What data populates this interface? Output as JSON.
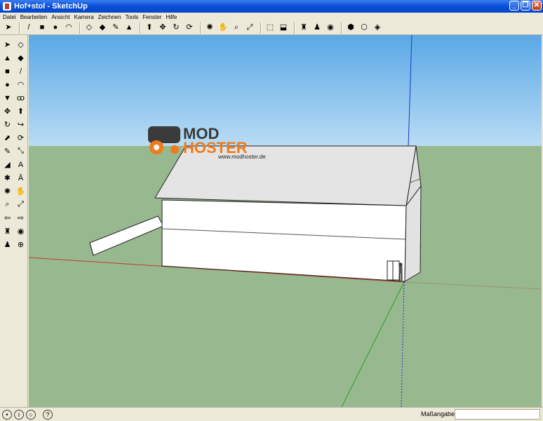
{
  "window": {
    "title": "Hof+stol - SketchUp"
  },
  "menu": [
    {
      "label": "Datei"
    },
    {
      "label": "Bearbeiten"
    },
    {
      "label": "Ansicht"
    },
    {
      "label": "Kamera"
    },
    {
      "label": "Zeichnen"
    },
    {
      "label": "Tools"
    },
    {
      "label": "Fenster"
    },
    {
      "label": "Hilfe"
    }
  ],
  "toolbar": [
    {
      "icon": "select-arrow-icon",
      "glyph": "➤"
    },
    {
      "icon": "sep"
    },
    {
      "icon": "line-pencil-icon",
      "glyph": "/"
    },
    {
      "icon": "rectangle-icon",
      "glyph": "■"
    },
    {
      "icon": "circle-icon",
      "glyph": "●"
    },
    {
      "icon": "arc-icon",
      "glyph": "◠"
    },
    {
      "icon": "sep"
    },
    {
      "icon": "make-component-icon",
      "glyph": "◇"
    },
    {
      "icon": "eraser-icon",
      "glyph": "◆"
    },
    {
      "icon": "tape-measure-icon",
      "glyph": "✎"
    },
    {
      "icon": "paint-bucket-icon",
      "glyph": "▲"
    },
    {
      "icon": "sep"
    },
    {
      "icon": "push-pull-icon",
      "glyph": "⬆"
    },
    {
      "icon": "move-icon",
      "glyph": "✥"
    },
    {
      "icon": "rotate-icon",
      "glyph": "↻"
    },
    {
      "icon": "offset-icon",
      "glyph": "⟳"
    },
    {
      "icon": "sep"
    },
    {
      "icon": "orbit-icon",
      "glyph": "✺"
    },
    {
      "icon": "pan-icon",
      "glyph": "✋"
    },
    {
      "icon": "zoom-icon",
      "glyph": "⌕"
    },
    {
      "icon": "zoom-extents-icon",
      "glyph": "⤢"
    },
    {
      "icon": "sep"
    },
    {
      "icon": "get-models-icon",
      "glyph": "⬚"
    },
    {
      "icon": "share-model-icon",
      "glyph": "⬓"
    },
    {
      "icon": "sep"
    },
    {
      "icon": "position-camera-icon",
      "glyph": "♜"
    },
    {
      "icon": "walk-icon",
      "glyph": "♟"
    },
    {
      "icon": "look-around-icon",
      "glyph": "◉"
    },
    {
      "icon": "sep"
    },
    {
      "icon": "get-photo-texture-icon",
      "glyph": "⬢"
    },
    {
      "icon": "components-icon",
      "glyph": "⬡"
    },
    {
      "icon": "materials-icon",
      "glyph": "◈"
    }
  ],
  "left_tools": [
    {
      "icon": "select-arrow-icon",
      "glyph": "➤"
    },
    {
      "icon": "make-component-icon",
      "glyph": "◇"
    },
    {
      "icon": "paint-bucket-icon",
      "glyph": "▲"
    },
    {
      "icon": "eraser-icon",
      "glyph": "◆"
    },
    {
      "icon": "rectangle-icon",
      "glyph": "■"
    },
    {
      "icon": "line-pencil-icon",
      "glyph": "/"
    },
    {
      "icon": "circle-icon",
      "glyph": "●"
    },
    {
      "icon": "arc-icon",
      "glyph": "◠"
    },
    {
      "icon": "polygon-icon",
      "glyph": "▼"
    },
    {
      "icon": "freehand-icon",
      "glyph": "ꝏ"
    },
    {
      "icon": "move-icon",
      "glyph": "✥"
    },
    {
      "icon": "push-pull-icon",
      "glyph": "⬆"
    },
    {
      "icon": "rotate-icon",
      "glyph": "↻"
    },
    {
      "icon": "follow-me-icon",
      "glyph": "↪"
    },
    {
      "icon": "scale-icon",
      "glyph": "⬈"
    },
    {
      "icon": "offset-icon",
      "glyph": "⟳"
    },
    {
      "icon": "tape-measure-icon",
      "glyph": "✎"
    },
    {
      "icon": "dimension-icon",
      "glyph": "⤡"
    },
    {
      "icon": "protractor-icon",
      "glyph": "◢"
    },
    {
      "icon": "text-icon",
      "glyph": "A"
    },
    {
      "icon": "axes-icon",
      "glyph": "✱"
    },
    {
      "icon": "3d-text-icon",
      "glyph": "Ā"
    },
    {
      "icon": "orbit-icon",
      "glyph": "✺"
    },
    {
      "icon": "pan-icon",
      "glyph": "✋"
    },
    {
      "icon": "zoom-icon",
      "glyph": "⌕"
    },
    {
      "icon": "zoom-extents-icon",
      "glyph": "⤢"
    },
    {
      "icon": "previous-view-icon",
      "glyph": "⇦"
    },
    {
      "icon": "next-view-icon",
      "glyph": "⇨"
    },
    {
      "icon": "position-camera-icon",
      "glyph": "♜"
    },
    {
      "icon": "look-around-icon",
      "glyph": "◉"
    },
    {
      "icon": "walk-icon",
      "glyph": "♟"
    },
    {
      "icon": "section-plane-icon",
      "glyph": "⊕"
    }
  ],
  "viewport": {
    "watermark": {
      "line1": "MOD",
      "line2": "HOSTER",
      "url": "www.modhoster.de"
    },
    "colors": {
      "sky_top": "#5aa8e6",
      "sky_bottom": "#b9dcf4",
      "ground": "#98b98f",
      "wall": "#ffffff",
      "roof": "#e4e4e4",
      "edge": "#222222"
    }
  },
  "status": {
    "icons": [
      {
        "icon": "geo-location-icon",
        "glyph": "•"
      },
      {
        "icon": "credits-icon",
        "glyph": "i"
      },
      {
        "icon": "user-icon",
        "glyph": "○"
      }
    ],
    "help_icon": {
      "icon": "help-icon",
      "glyph": "?"
    },
    "measure_label": "Maßangaben",
    "measure_value": ""
  }
}
